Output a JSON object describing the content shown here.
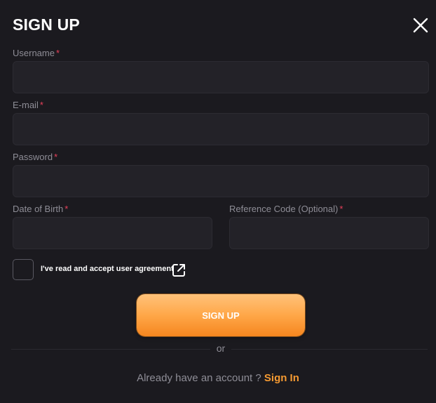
{
  "header": {
    "title": "SIGN UP",
    "close_icon": "close-icon"
  },
  "form": {
    "required_mark": "*",
    "username": {
      "label": "Username",
      "value": "",
      "placeholder": ""
    },
    "email": {
      "label": "E-mail",
      "value": "",
      "placeholder": ""
    },
    "password": {
      "label": "Password",
      "value": "",
      "placeholder": ""
    },
    "dob": {
      "label": "Date of Birth",
      "value": "",
      "placeholder": ""
    },
    "reference": {
      "label": "Reference Code (Optional)",
      "value": "",
      "placeholder": ""
    },
    "agreement": {
      "label": "I've read and accept user agreement",
      "checked": false,
      "link_icon": "external-link-icon"
    },
    "submit_label": "SIGN UP"
  },
  "footer": {
    "or_text": "or",
    "prompt": "Already have an account ?",
    "signin_label": "Sign In"
  },
  "colors": {
    "background": "#1b1a1f",
    "input_bg": "#232228",
    "accent": "#f59a32",
    "required": "#e6405a",
    "label": "#8e8d96"
  }
}
